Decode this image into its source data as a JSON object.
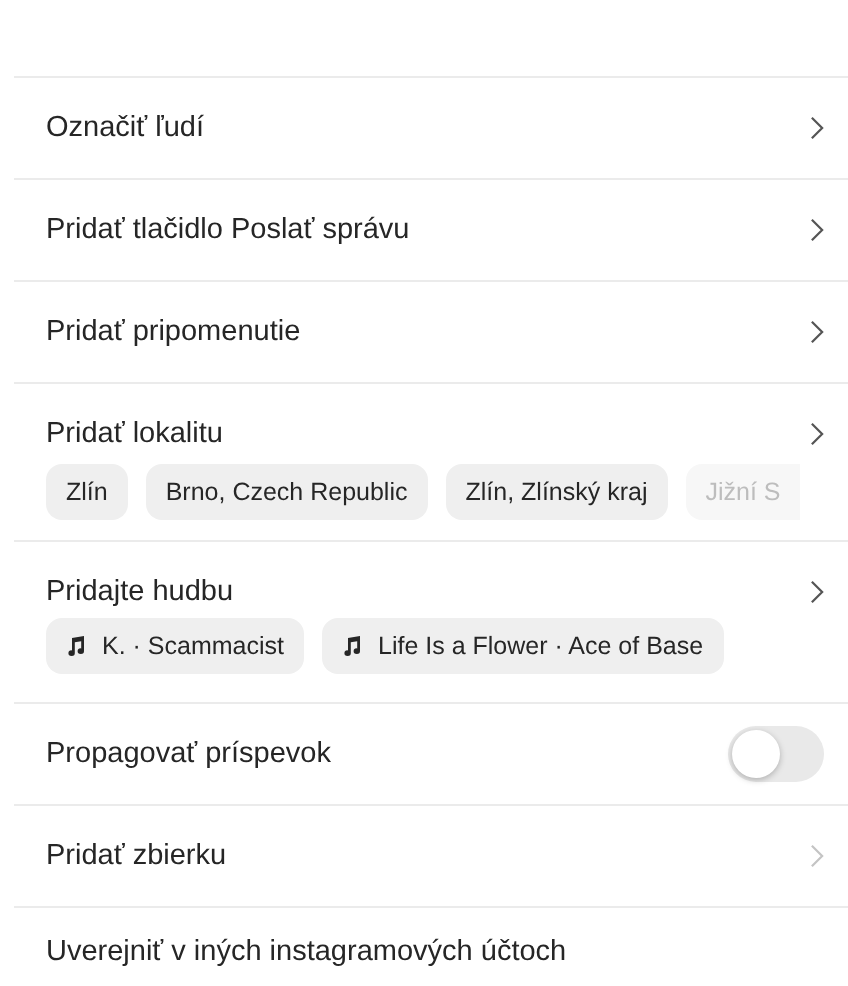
{
  "rows": [
    {
      "kind": "link",
      "label": "Označiť ľudí",
      "disabled": false
    },
    {
      "kind": "link",
      "label": "Pridať tlačidlo Poslať správu",
      "disabled": false
    },
    {
      "kind": "link",
      "label": "Pridať pripomenutie",
      "disabled": false
    },
    {
      "kind": "link",
      "label": "Pridať lokalitu",
      "disabled": false,
      "chips": [
        {
          "label": "Zlín",
          "faded": false
        },
        {
          "label": "Brno, Czech Republic",
          "faded": false
        },
        {
          "label": "Zlín, Zlínský kraj",
          "faded": false
        },
        {
          "label": "Jižní S",
          "faded": true
        }
      ]
    },
    {
      "kind": "link",
      "label": "Pridajte hudbu",
      "disabled": false,
      "music": [
        {
          "label": "K. · Scammacist"
        },
        {
          "label": "Life Is a Flower · Ace of Base"
        }
      ]
    },
    {
      "kind": "toggle",
      "label": "Propagovať príspevok",
      "on": false
    },
    {
      "kind": "link",
      "label": "Pridať zbierku",
      "disabled": true
    },
    {
      "kind": "plain",
      "label": "Uverejniť v iných instagramových účtoch"
    }
  ]
}
